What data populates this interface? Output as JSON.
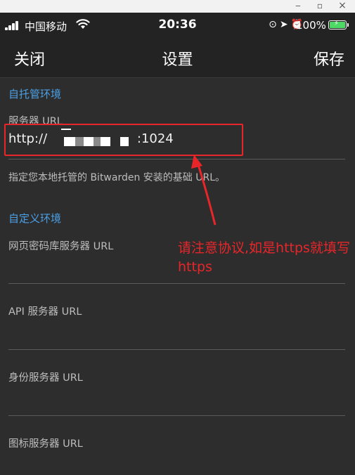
{
  "status_bar": {
    "carrier": "中国移动",
    "time": "20:36",
    "battery": "100%"
  },
  "nav": {
    "close": "关闭",
    "title": "设置",
    "save": "保存"
  },
  "self_hosted": {
    "header": "自托管环境",
    "server_url_label": "服务器 URL",
    "server_url_prefix": "http://",
    "server_url_suffix": ":1024",
    "help": "指定您本地托管的 Bitwarden 安装的基础 URL。"
  },
  "custom": {
    "header": "自定义环境",
    "fields": [
      {
        "label": "网页密码库服务器 URL",
        "value": ""
      },
      {
        "label": "API 服务器 URL",
        "value": ""
      },
      {
        "label": "身份服务器 URL",
        "value": ""
      },
      {
        "label": "图标服务器 URL",
        "value": ""
      }
    ]
  },
  "annotation": {
    "text": "请注意协议,如是https就填写https",
    "color": "#e8262a"
  },
  "colors": {
    "accent": "#4aa0e6",
    "background": "#2d2d2d",
    "bar": "#232323"
  }
}
